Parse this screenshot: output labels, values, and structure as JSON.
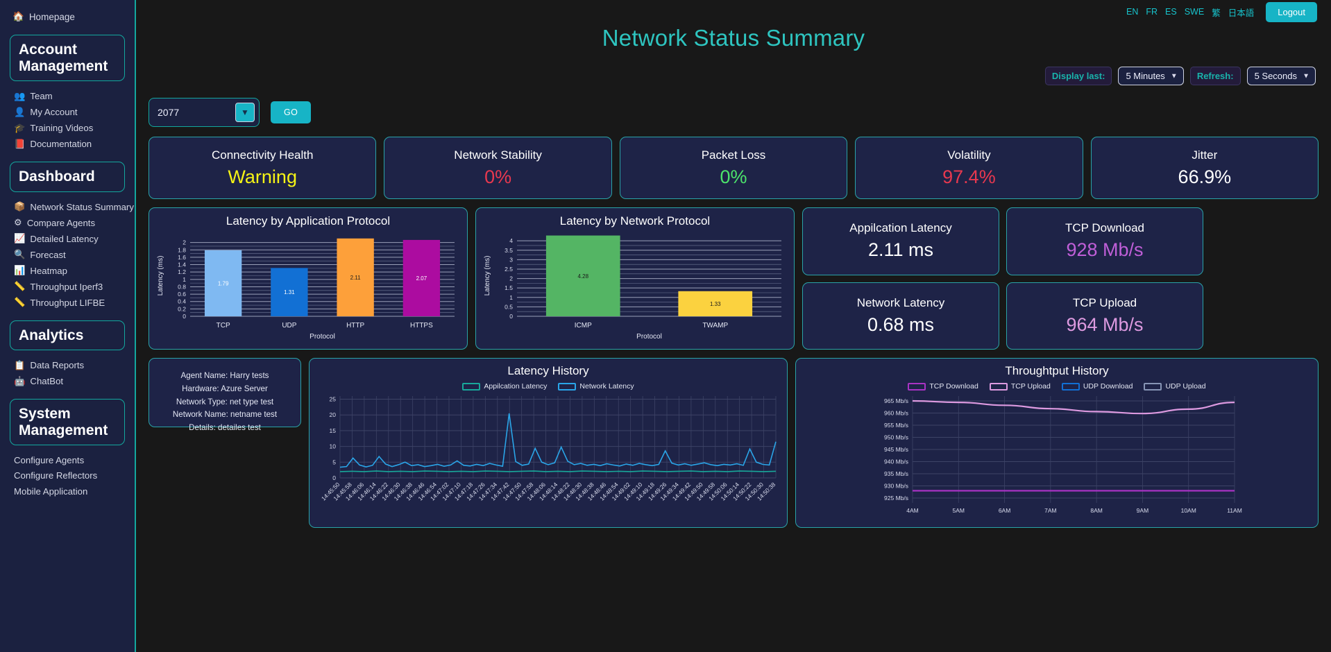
{
  "sidebar": {
    "home": {
      "label": "Homepage",
      "icon": "home-icon"
    },
    "sections": [
      {
        "title": "Account Management",
        "items": [
          {
            "label": "Team",
            "icon": "team-icon"
          },
          {
            "label": "My Account",
            "icon": "user-check-icon"
          },
          {
            "label": "Training Videos",
            "icon": "graduation-icon"
          },
          {
            "label": "Documentation",
            "icon": "book-icon"
          }
        ]
      },
      {
        "title": "Dashboard",
        "items": [
          {
            "label": "Network Status Summary",
            "icon": "box-icon"
          },
          {
            "label": "Compare Agents",
            "icon": "compare-icon"
          },
          {
            "label": "Detailed Latency",
            "icon": "chart-line-icon"
          },
          {
            "label": "Forecast",
            "icon": "search-icon"
          },
          {
            "label": "Heatmap",
            "icon": "heatmap-icon"
          },
          {
            "label": "Throughput Iperf3",
            "icon": "gauge-icon"
          },
          {
            "label": "Throughput LIFBE",
            "icon": "gauge-icon"
          }
        ]
      },
      {
        "title": "Analytics",
        "items": [
          {
            "label": "Data Reports",
            "icon": "report-icon"
          },
          {
            "label": "ChatBot",
            "icon": "robot-icon"
          }
        ]
      },
      {
        "title": "System Management",
        "items": [
          {
            "label": "Configure Agents",
            "icon": ""
          },
          {
            "label": "Configure Reflectors",
            "icon": ""
          },
          {
            "label": "Mobile Application",
            "icon": ""
          }
        ]
      }
    ]
  },
  "header": {
    "title": "Network Status Summary",
    "languages": [
      "EN",
      "FR",
      "ES",
      "SWE",
      "繁",
      "日本語"
    ],
    "logout_label": "Logout"
  },
  "controls": {
    "display_last_label": "Display last:",
    "display_last_value": "5 Minutes",
    "refresh_label": "Refresh:",
    "refresh_value": "5 Seconds",
    "agent_value": "2077",
    "go_label": "GO"
  },
  "kpis": [
    {
      "title": "Connectivity Health",
      "value": "Warning",
      "color": "#f5f316"
    },
    {
      "title": "Network Stability",
      "value": "0%",
      "color": "#e8384f"
    },
    {
      "title": "Packet Loss",
      "value": "0%",
      "color": "#4ce46b"
    },
    {
      "title": "Volatility",
      "value": "97.4%",
      "color": "#e8384f"
    },
    {
      "title": "Jitter",
      "value": "66.9%",
      "color": "#ffffff"
    }
  ],
  "metrics": [
    {
      "title": "Appilcation Latency",
      "value": "2.11 ms",
      "color": "#ffffff"
    },
    {
      "title": "TCP Download",
      "value": "928 Mb/s",
      "color": "#c05fd8"
    },
    {
      "title": "Network Latency",
      "value": "0.68 ms",
      "color": "#ffffff"
    },
    {
      "title": "TCP Upload",
      "value": "964 Mb/s",
      "color": "#dd9ae0"
    }
  ],
  "agent_info": {
    "lines": [
      "Agent Name: Harry tests",
      "Hardware: Azure Server",
      "Network Type: net type test",
      "Network Name: netname test",
      "Details: detailes test"
    ]
  },
  "chart_data": [
    {
      "type": "bar",
      "title": "Latency by Application Protocol",
      "xlabel": "Protocol",
      "ylabel": "Latency (ms)",
      "categories": [
        "TCP",
        "UDP",
        "HTTP",
        "HTTPS"
      ],
      "values": [
        1.79,
        1.31,
        2.11,
        2.07
      ],
      "colors": [
        "#7fb9f2",
        "#1270d4",
        "#fda03a",
        "#ac0ca0"
      ],
      "ylim": [
        0,
        2.2
      ],
      "yticks": [
        0,
        0.2,
        0.4,
        0.6,
        0.8,
        1,
        1.2,
        1.4,
        1.6,
        1.8,
        2
      ],
      "ytick_labels": [
        "0",
        "0.2",
        "0.4",
        "0.6",
        "0.8",
        "1",
        "1.2",
        "1.4",
        "1.6",
        "1.8",
        "2"
      ],
      "grid": true,
      "legend": "none"
    },
    {
      "type": "bar",
      "title": "Latency by Network Protocol",
      "xlabel": "Protocol",
      "ylabel": "Latency (ms)",
      "categories": [
        "ICMP",
        "TWAMP"
      ],
      "values": [
        4.28,
        1.33
      ],
      "colors": [
        "#54b564",
        "#fbd23f"
      ],
      "ylim": [
        0,
        4.3
      ],
      "yticks": [
        0,
        0.5,
        1,
        1.5,
        2,
        2.5,
        3,
        3.5,
        4
      ],
      "ytick_labels": [
        "0",
        "0.5",
        "1",
        "1.5",
        "2",
        "2.5",
        "3",
        "3.5",
        "4"
      ],
      "grid": true,
      "legend": "none"
    },
    {
      "type": "line",
      "title": "Latency History",
      "xlabel": "",
      "ylabel": "",
      "ylim": [
        0,
        26
      ],
      "yticks": [
        0,
        5,
        10,
        15,
        20,
        25
      ],
      "ytick_labels": [
        "0",
        "5",
        "10",
        "15",
        "20",
        "25"
      ],
      "grid": true,
      "legend": "top",
      "x": [
        "14:45:50",
        "14:45:58",
        "14:46:06",
        "14:46:14",
        "14:46:22",
        "14:46:30",
        "14:46:38",
        "14:46:46",
        "14:46:54",
        "14:47:02",
        "14:47:10",
        "14:47:18",
        "14:47:26",
        "14:47:34",
        "14:47:42",
        "14:47:50",
        "14:47:58",
        "14:48:06",
        "14:48:14",
        "14:48:22",
        "14:48:30",
        "14:48:38",
        "14:48:46",
        "14:48:54",
        "14:49:02",
        "14:49:10",
        "14:49:18",
        "14:49:26",
        "14:49:34",
        "14:49:42",
        "14:49:50",
        "14:49:58",
        "14:50:06",
        "14:50:14",
        "14:50:22",
        "14:50:30",
        "14:50:38"
      ],
      "series": [
        {
          "name": "Appilcation Latency",
          "color": "#18a89a",
          "values": [
            2.0,
            2.1,
            2.0,
            2.2,
            2.0,
            2.1,
            2.0,
            2.2,
            2.1,
            2.0,
            2.1,
            2.0,
            2.2,
            2.1,
            2.0,
            2.1,
            2.2,
            2.0,
            2.1,
            2.0,
            2.2,
            2.1,
            2.0,
            2.1,
            2.0,
            2.2,
            2.1,
            2.0,
            2.1,
            2.2,
            2.0,
            2.1,
            2.0,
            2.2,
            2.1,
            2.0,
            2.1
          ]
        },
        {
          "name": "Network Latency",
          "color": "#2aa5e8",
          "values": [
            3.4,
            3.6,
            6.3,
            4.1,
            3.5,
            4.0,
            6.8,
            4.4,
            3.6,
            4.2,
            5.0,
            3.9,
            4.2,
            3.6,
            3.9,
            4.3,
            3.7,
            4.1,
            5.4,
            4.0,
            3.8,
            4.3,
            3.9,
            4.6,
            4.1,
            3.7,
            20.5,
            5.2,
            4.0,
            4.4,
            9.4,
            5.0,
            4.2,
            4.8,
            9.8,
            5.3,
            4.2,
            4.6,
            4.0,
            4.3,
            3.9,
            4.5,
            4.1,
            3.8,
            4.4,
            4.0,
            4.6,
            4.2,
            3.9,
            4.3,
            8.6,
            4.7,
            4.1,
            4.5,
            4.0,
            4.4,
            4.8,
            4.2,
            3.9,
            4.3,
            4.1,
            4.5,
            4.0,
            9.2,
            5.0,
            4.3,
            4.1,
            11.5
          ]
        }
      ]
    },
    {
      "type": "line",
      "title": "Throughtput History",
      "xlabel": "",
      "ylabel": "Mb/s",
      "ylim": [
        923,
        967
      ],
      "yticks": [
        925,
        930,
        935,
        940,
        945,
        950,
        955,
        960,
        965
      ],
      "ytick_labels": [
        "925 Mb/s",
        "930 Mb/s",
        "935 Mb/s",
        "940 Mb/s",
        "945 Mb/s",
        "950 Mb/s",
        "955 Mb/s",
        "960 Mb/s",
        "965 Mb/s"
      ],
      "x": [
        "4AM",
        "5AM",
        "6AM",
        "7AM",
        "8AM",
        "9AM",
        "10AM",
        "11AM"
      ],
      "grid": true,
      "legend": "top",
      "series": [
        {
          "name": "TCP Download",
          "color": "#a933c4",
          "values": [
            928,
            928,
            928,
            928,
            928,
            928,
            928,
            928
          ]
        },
        {
          "name": "TCP Upload",
          "color": "#dd9ae0",
          "values": [
            965,
            964.4,
            963.2,
            961.8,
            960.6,
            959.8,
            961.6,
            964.4
          ]
        },
        {
          "name": "UDP Download",
          "color": "#1270d4",
          "values": []
        },
        {
          "name": "UDP Upload",
          "color": "#8795b5",
          "values": []
        }
      ]
    }
  ]
}
